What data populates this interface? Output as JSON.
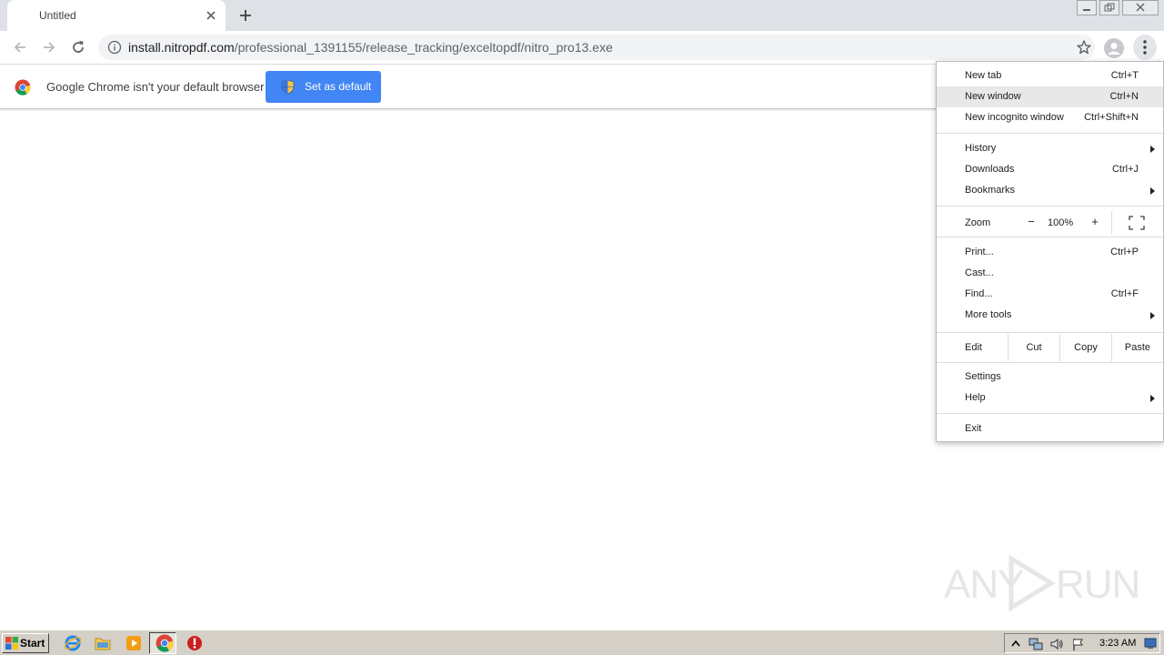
{
  "tab": {
    "title": "Untitled"
  },
  "address_bar": {
    "host": "install.nitropdf.com",
    "path": "/professional_1391155/release_tracking/exceltopdf/nitro_pro13.exe"
  },
  "infobar": {
    "message": "Google Chrome isn't your default browser",
    "button_label": "Set as default"
  },
  "menu": {
    "group1": [
      {
        "label": "New tab",
        "shortcut": "Ctrl+T"
      },
      {
        "label": "New window",
        "shortcut": "Ctrl+N"
      },
      {
        "label": "New incognito window",
        "shortcut": "Ctrl+Shift+N"
      }
    ],
    "group2": [
      {
        "label": "History",
        "shortcut": ""
      },
      {
        "label": "Downloads",
        "shortcut": "Ctrl+J"
      },
      {
        "label": "Bookmarks",
        "shortcut": ""
      }
    ],
    "zoom": {
      "label": "Zoom",
      "minus": "−",
      "value": "100%",
      "plus": "+"
    },
    "group3": [
      {
        "label": "Print...",
        "shortcut": "Ctrl+P"
      },
      {
        "label": "Cast...",
        "shortcut": ""
      },
      {
        "label": "Find...",
        "shortcut": "Ctrl+F"
      },
      {
        "label": "More tools",
        "shortcut": ""
      }
    ],
    "edit": {
      "label": "Edit",
      "cut": "Cut",
      "copy": "Copy",
      "paste": "Paste"
    },
    "group4": [
      {
        "label": "Settings",
        "shortcut": ""
      },
      {
        "label": "Help",
        "shortcut": ""
      }
    ],
    "exit": {
      "label": "Exit"
    }
  },
  "watermark": {
    "left": "ANY",
    "right": "RUN"
  },
  "taskbar": {
    "start_label": "Start",
    "clock": "3:23 AM"
  },
  "colors": {
    "accent": "#4285f4",
    "menu_highlight": "#e8e8e8",
    "taskbar": "#d4d0c8"
  }
}
